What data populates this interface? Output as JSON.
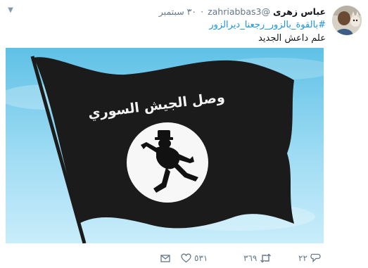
{
  "tweet": {
    "author_name": "عباس زهرى",
    "handle": "@zahriabbas3",
    "date": "٣٠ سبتمبر",
    "hashtag": "#بالقوة_بالزور_رجعنا_ديرالزور",
    "text": "علم داعش الجديد"
  },
  "media": {
    "flag_caption": "وصل الجيش السوري",
    "flag_color": "#1b1b1b",
    "sky_color": "#7ccfee"
  },
  "actions": {
    "replies": "٢٢",
    "retweets": "٣٦٩",
    "likes": "٥٣١"
  },
  "colors": {
    "hashtag": "#1b95e0",
    "meta": "#657786",
    "name": "#14171a"
  }
}
